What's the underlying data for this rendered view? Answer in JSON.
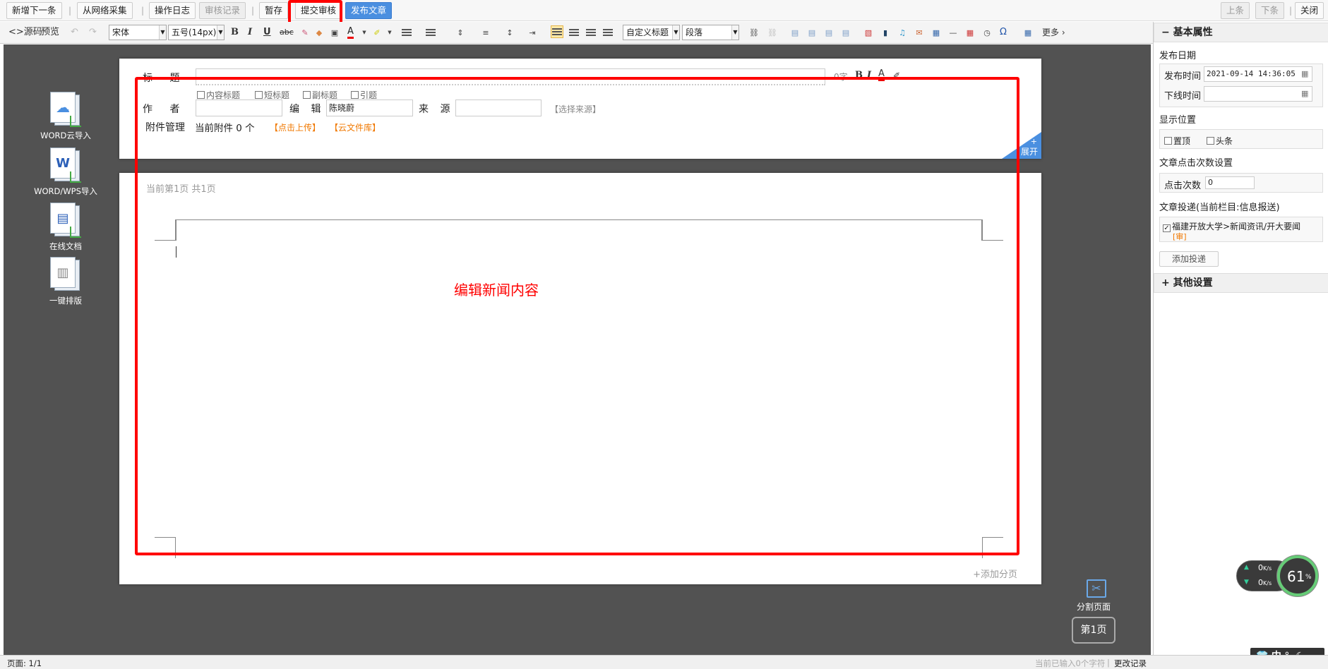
{
  "topbar": {
    "buttons": [
      "新增下一条",
      "从网络采集",
      "操作日志",
      "审核记录",
      "暂存",
      "提交审核",
      "发布文章"
    ],
    "right_buttons": [
      "上条",
      "下条",
      "关闭"
    ],
    "separator": "|"
  },
  "toolbar": {
    "source": "<>源码",
    "preview": "预览",
    "font_family": "宋体",
    "font_size": "五号(14px)",
    "style_select": "自定义标题",
    "paragraph_select": "段落",
    "more": "更多",
    "bold": "B",
    "italic": "I",
    "underline": "U",
    "font_color": "A",
    "omega": "Ω"
  },
  "left_tools": [
    {
      "label": "WORD云导入",
      "icon": "cloud-import-icon"
    },
    {
      "label": "WORD/WPS导入",
      "icon": "word-import-icon"
    },
    {
      "label": "在线文档",
      "icon": "online-doc-icon"
    },
    {
      "label": "一键排版",
      "icon": "auto-layout-icon"
    }
  ],
  "meta_form": {
    "title_label": "标  题",
    "title_value": "",
    "word_count_icon": "0字",
    "title_checks": [
      "内容标题",
      "短标题",
      "副标题",
      "引题"
    ],
    "author_label": "作  者",
    "author_value": "",
    "editor_label": "编  辑",
    "editor_value": "陈晓蔚",
    "source_label": "来  源",
    "source_value": "",
    "select_source": "【选择来源】",
    "attach_label": "附件管理",
    "attach_count": "当前附件  0 个",
    "upload": "【点击上传】",
    "cloud_lib": "【云文件库】",
    "expand": "展开",
    "expand_plus": "+"
  },
  "editor": {
    "page_info": "当前第1页   共1页",
    "annotation": "编辑新闻内容",
    "add_page": "+添加分页"
  },
  "split": {
    "label": "分割页面",
    "page_btn": "第1页"
  },
  "right_panel": {
    "basic_header": "基本属性",
    "basic_sign": "−",
    "publish_date": "发布日期",
    "publish_time_label": "发布时间",
    "publish_time_value": "2021-09-14 14:36:05",
    "offline_label": "下线时间",
    "offline_value": "",
    "display_pos": "显示位置",
    "pos_options": [
      "置顶",
      "头条"
    ],
    "clicks_title": "文章点击次数设置",
    "clicks_label": "点击次数",
    "clicks_value": "0",
    "delivery_title": "文章投递(当前栏目:信息报送)",
    "delivery_item": "福建开放大学>新闻资讯/开大要闻",
    "delivery_tag": "[审]",
    "add_delivery": "添加投递",
    "other_header": "其他设置",
    "other_sign": "+"
  },
  "status": {
    "page": "页面: 1/1",
    "chars": "当前已输入0个字符",
    "change_log": "更改记录"
  },
  "net_widget": {
    "up": "0",
    "down": "0",
    "unit": "K/s",
    "percent": "61",
    "percent_sign": "%",
    "ime": "中"
  },
  "colors": {
    "accent_blue": "#4a8fe0",
    "annotation_red": "#ff0000",
    "link_orange": "#f07800",
    "canvas": "#525252"
  }
}
